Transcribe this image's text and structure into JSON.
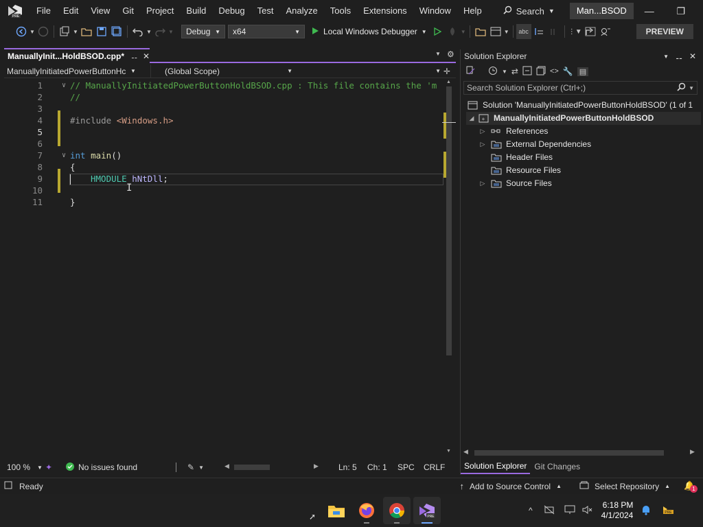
{
  "menu": {
    "items": [
      "File",
      "Edit",
      "View",
      "Git",
      "Project",
      "Build",
      "Debug",
      "Test",
      "Analyze",
      "Tools",
      "Extensions",
      "Window",
      "Help"
    ],
    "search_label": "Search",
    "solution_name": "Man...BSOD"
  },
  "toolbar": {
    "config": "Debug",
    "platform": "x64",
    "run_label": "Local Windows Debugger",
    "preview_label": "PREVIEW"
  },
  "editor": {
    "tab_title": "ManuallyInit...HoldBSOD.cpp*",
    "nav_project": "ManuallyInitiatedPowerButtonHc",
    "nav_scope": "(Global Scope)",
    "lines": [
      {
        "n": "1"
      },
      {
        "n": "2"
      },
      {
        "n": "3"
      },
      {
        "n": "4"
      },
      {
        "n": "5"
      },
      {
        "n": "6"
      },
      {
        "n": "7"
      },
      {
        "n": "8"
      },
      {
        "n": "9"
      },
      {
        "n": "10"
      },
      {
        "n": "11"
      }
    ],
    "code": {
      "l1": "// ManuallyInitiatedPowerButtonHoldBSOD.cpp : This file contains the 'm",
      "l2": "//",
      "l4_kw": "#include ",
      "l4_str": "<Windows.h>",
      "l7_kw": "int ",
      "l7_fn": "main",
      "l7_rest": "()",
      "l8": "{",
      "l9_type": "HMODULE ",
      "l9_var": "hNtDll",
      "l9_rest": ";",
      "l11": "}"
    },
    "zoom": "100 %",
    "issues": "No issues found",
    "ln": "Ln: 5",
    "ch": "Ch: 1",
    "spc": "SPC",
    "crlf": "CRLF"
  },
  "solution_explorer": {
    "title": "Solution Explorer",
    "search_placeholder": "Search Solution Explorer (Ctrl+;)",
    "solution_row": "Solution 'ManuallyInitiatedPowerButtonHoldBSOD' (1 of 1",
    "project_row": "ManuallyInitiatedPowerButtonHoldBSOD",
    "children": [
      "References",
      "External Dependencies",
      "Header Files",
      "Resource Files",
      "Source Files"
    ],
    "tab_se": "Solution Explorer",
    "tab_git": "Git Changes"
  },
  "status": {
    "ready": "Ready",
    "add_source": "Add to Source Control",
    "select_repo": "Select Repository",
    "notif_count": "1"
  },
  "taskbar": {
    "time": "6:18 PM",
    "date": "4/1/2024"
  },
  "colors": {
    "accent": "#9a6ae0",
    "run_green": "#3fb950"
  }
}
